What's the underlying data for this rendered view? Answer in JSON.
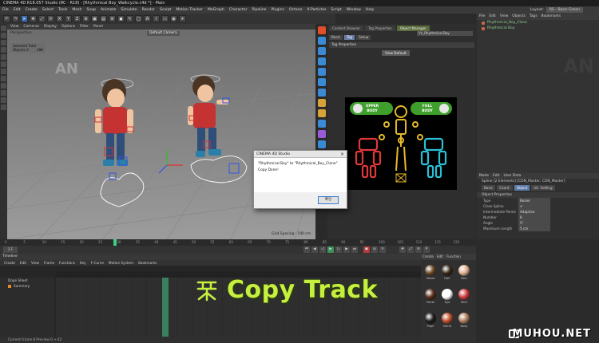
{
  "window": {
    "title": "CINEMA 4D R18.057 Studio (RC - R18) - [Rhythmical Boy_Walkcycle.c4d *] - Main"
  },
  "menubar": [
    "File",
    "Edit",
    "Create",
    "Select",
    "Tools",
    "Mesh",
    "Snap",
    "Animate",
    "Simulate",
    "Render",
    "Sculpt",
    "Motion Tracker",
    "MoGraph",
    "Character",
    "Pipeline",
    "Plugins",
    "Octane",
    "X-Particles",
    "Script",
    "Window",
    "Help"
  ],
  "layout": {
    "label": "Layout:",
    "value": "RS - Basic Green"
  },
  "viewport": {
    "menu": [
      "View",
      "Cameras",
      "Display",
      "Options",
      "Filter",
      "Panel"
    ],
    "name": "Perspective",
    "camera": "Default Camera",
    "hud_total": "Selected Total",
    "hud_objects": "Objects   2",
    "hud_objects_val": "288",
    "grid_spacing": "Grid Spacing : 100 cm",
    "watermark": "AN"
  },
  "right_panel": {
    "tabs": [
      "Content Browser",
      "Tag Properties",
      "Object Manager"
    ],
    "tag_field": "Vn_Rhythmical Boy",
    "subtabs": [
      "Basic",
      "Tag",
      "Setup"
    ],
    "section": "Tag Properties",
    "view_default": "View Default",
    "upper_body": "UPPER BODY",
    "full_body": "FULL BODY"
  },
  "object_manager": {
    "menu": [
      "File",
      "Edit",
      "View",
      "Objects",
      "Tags",
      "Bookmarks"
    ],
    "rows": [
      "Rhythmical_Boy_Clone",
      "Rhythmical Boy"
    ],
    "watermark": "AN"
  },
  "attribute_manager": {
    "menu": [
      "Mode",
      "Edit",
      "User Data"
    ],
    "title": "Spline [2 Elements] [CON_Master, CON_Master]",
    "tabs": [
      "Basic",
      "Coord.",
      "Object",
      "Int. Setting"
    ],
    "section": "Object Properties",
    "rows": [
      {
        "k": "Type",
        "v": "Bezier"
      },
      {
        "k": "Close Spline",
        "v": "✔"
      },
      {
        "k": "Intermediate Points",
        "v": "Adaptive"
      },
      {
        "k": "Number",
        "v": "8"
      },
      {
        "k": "Angle",
        "v": "5°"
      },
      {
        "k": "Maximum Length",
        "v": "5 cm"
      }
    ]
  },
  "time_ticks": [
    "0",
    "5",
    "10",
    "15",
    "20",
    "25",
    "30",
    "35",
    "40",
    "45",
    "50",
    "55",
    "60",
    "65",
    "70",
    "75",
    "80",
    "85",
    "90",
    "95",
    "100",
    "105",
    "110",
    "115",
    "120"
  ],
  "timeline": {
    "title": "Timeline",
    "menu": [
      "Create",
      "Edit",
      "View",
      "Frame",
      "Functions",
      "Key",
      "F-Curve",
      "Motion System",
      "Bookmarks"
    ],
    "rows": [
      "Dope Sheet",
      "Summary"
    ],
    "footer": "Current Frame  8   Preview  0 → 42",
    "current_frame": "2 F"
  },
  "overlay": {
    "text": "Copy Track"
  },
  "material_manager": {
    "menu": [
      "Create",
      "Edit",
      "Function"
    ],
    "materials": [
      "Shoes",
      "Hair",
      "Skin",
      "Pants",
      "Eye",
      "Shirt",
      "Pupil",
      "Shirt2",
      "Body"
    ]
  },
  "dialog": {
    "title": "CINEMA 4D Studio",
    "line1": "\"Rhythmical Boy\" to \"Rhythmical_Boy_Clone\"",
    "line2": "Copy Done!",
    "ok": "확인"
  },
  "site_watermark": "MUHOU.NET",
  "colors": {
    "accent_green": "#c6f03f",
    "ragdoll_red": "#e0383a",
    "ragdoll_cyan": "#2ac0d6",
    "ragdoll_yellow": "#e6b92a",
    "upper_green": "#3f9f2c"
  }
}
